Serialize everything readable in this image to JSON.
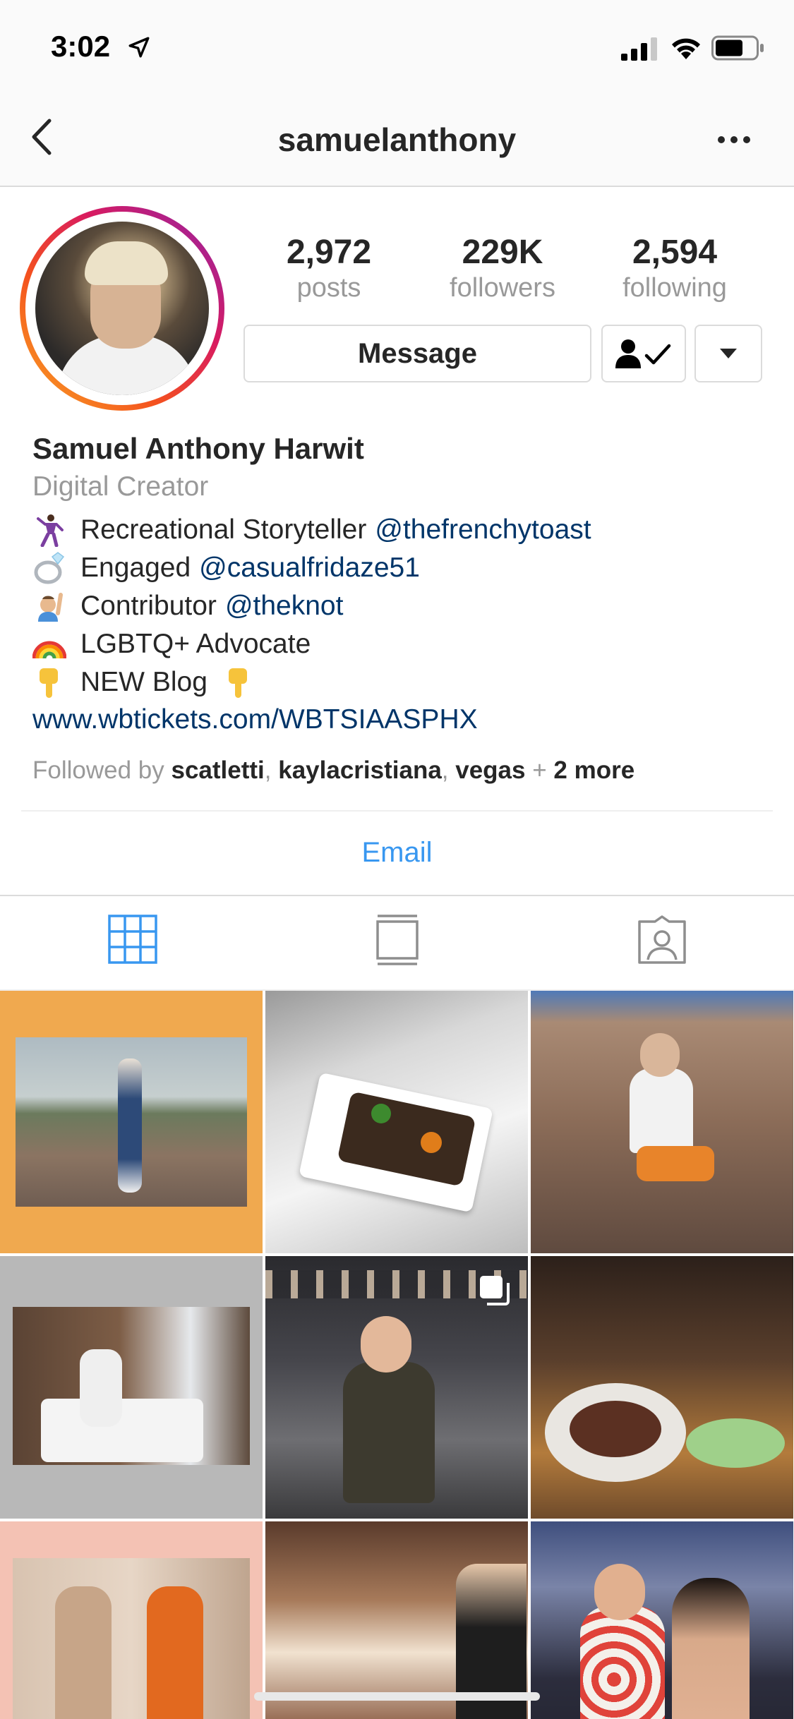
{
  "status_bar": {
    "time": "3:02"
  },
  "nav": {
    "title": "samuelanthony"
  },
  "stats": [
    {
      "value": "2,972",
      "label": "posts"
    },
    {
      "value": "229K",
      "label": "followers"
    },
    {
      "value": "2,594",
      "label": "following"
    }
  ],
  "buttons": {
    "message": "Message"
  },
  "bio": {
    "full_name": "Samuel Anthony Harwit",
    "category": "Digital Creator",
    "lines": [
      {
        "emoji": "dancing-man-emoji",
        "text": "Recreational Storyteller",
        "mention": "@thefrenchytoast"
      },
      {
        "emoji": "ring-emoji",
        "text": "Engaged",
        "mention": "@casualfridaze51"
      },
      {
        "emoji": "raising-hand-emoji",
        "text": "Contributor",
        "mention": "@theknot"
      },
      {
        "emoji": "rainbow-emoji",
        "text": "LGBTQ+ Advocate",
        "mention": ""
      },
      {
        "emoji": "pointing-down-emoji",
        "text": "NEW Blog",
        "mention": ""
      }
    ],
    "link": "www.wbtickets.com/WBTSIAASPHX",
    "followed_by_prefix": "Followed by",
    "followed_by_users": [
      "scatletti",
      "kaylacristiana",
      "vegas"
    ],
    "followed_by_more": "2 more"
  },
  "email_label": "Email",
  "tabs": [
    {
      "name": "grid-view",
      "active": true
    },
    {
      "name": "feed-view",
      "active": false
    },
    {
      "name": "tagged-view",
      "active": false
    }
  ],
  "grid_posts": [
    {
      "subject": "man walking in park",
      "frame_color": "#f0a94f"
    },
    {
      "subject": "food plate appetizer"
    },
    {
      "subject": "man sitting in desert"
    },
    {
      "subject": "man on hotel bed",
      "frame_color": "#b8b8b8"
    },
    {
      "subject": "man on escalator",
      "multi": true
    },
    {
      "subject": "dinner plate"
    },
    {
      "subject": "two men in hallway",
      "frame_color": "#f4c2b4"
    },
    {
      "subject": "man in lobby"
    },
    {
      "subject": "couple at night"
    }
  ],
  "colors": {
    "link": "#003569",
    "accent": "#3897f0",
    "secondary_text": "#999999"
  }
}
